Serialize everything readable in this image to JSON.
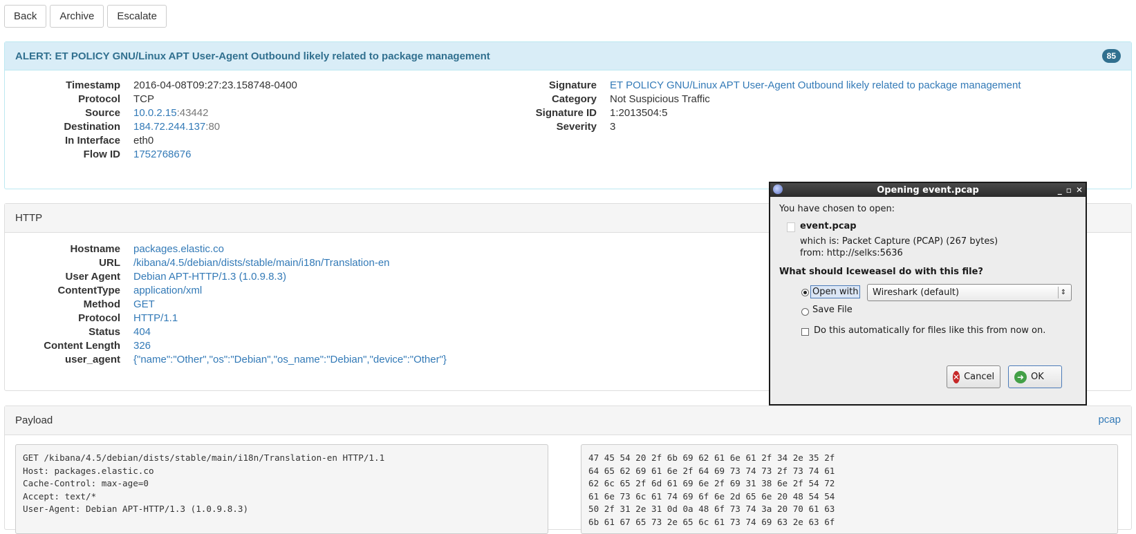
{
  "toolbar": {
    "back": "Back",
    "archive": "Archive",
    "escalate": "Escalate"
  },
  "alert": {
    "title": "ALERT: ET POLICY GNU/Linux APT User-Agent Outbound likely related to package management",
    "badge": "85",
    "left": [
      {
        "key": "Timestamp",
        "value": "2016-04-08T09:27:23.158748-0400"
      },
      {
        "key": "Protocol",
        "value": "TCP"
      },
      {
        "key": "Source",
        "value": "10.0.2.15",
        "port": ":43442"
      },
      {
        "key": "Destination",
        "value": "184.72.244.137",
        "port": ":80"
      },
      {
        "key": "In Interface",
        "value": "eth0"
      },
      {
        "key": "Flow ID",
        "value": "1752768676"
      }
    ],
    "right": [
      {
        "key": "Signature",
        "value": "ET POLICY GNU/Linux APT User-Agent Outbound likely related to package management"
      },
      {
        "key": "Category",
        "value": "Not Suspicious Traffic"
      },
      {
        "key": "Signature ID",
        "value": "1:2013504:5"
      },
      {
        "key": "Severity",
        "value": "3"
      }
    ]
  },
  "http": {
    "title": "HTTP",
    "rows": [
      {
        "key": "Hostname",
        "value": "packages.elastic.co"
      },
      {
        "key": "URL",
        "value": "/kibana/4.5/debian/dists/stable/main/i18n/Translation-en"
      },
      {
        "key": "User Agent",
        "value": "Debian APT-HTTP/1.3 (1.0.9.8.3)"
      },
      {
        "key": "ContentType",
        "value": "application/xml"
      },
      {
        "key": "Method",
        "value": "GET"
      },
      {
        "key": "Protocol",
        "value": "HTTP/1.1"
      },
      {
        "key": "Status",
        "value": "404"
      },
      {
        "key": "Content Length",
        "value": "326"
      },
      {
        "key": "user_agent",
        "value": "{\"name\":\"Other\",\"os\":\"Debian\",\"os_name\":\"Debian\",\"device\":\"Other\"}"
      }
    ]
  },
  "payload": {
    "title": "Payload",
    "pcap_link": "pcap",
    "text": "GET /kibana/4.5/debian/dists/stable/main/i18n/Translation-en HTTP/1.1\nHost: packages.elastic.co\nCache-Control: max-age=0\nAccept: text/*\nUser-Agent: Debian APT-HTTP/1.3 (1.0.9.8.3)",
    "hex": "47 45 54 20 2f 6b 69 62 61 6e 61 2f 34 2e 35 2f\n64 65 62 69 61 6e 2f 64 69 73 74 73 2f 73 74 61\n62 6c 65 2f 6d 61 69 6e 2f 69 31 38 6e 2f 54 72\n61 6e 73 6c 61 74 69 6f 6e 2d 65 6e 20 48 54 54\n50 2f 31 2e 31 0d 0a 48 6f 73 74 3a 20 70 61 63\n6b 61 67 65 73 2e 65 6c 61 73 74 69 63 2e 63 6f"
  },
  "dialog": {
    "title": "Opening event.pcap",
    "chosen": "You have chosen to open:",
    "filename": "event.pcap",
    "which_is": "which is:  Packet Capture (PCAP) (267 bytes)",
    "from": "from:  http://selks:5636",
    "question": "What should Iceweasel do with this file?",
    "open_with": "Open with",
    "app": "Wireshark (default)",
    "save_file": "Save File",
    "auto": "Do this automatically for files like this from now on.",
    "cancel": "Cancel",
    "ok": "OK",
    "controls": {
      "minimize": "_",
      "maximize": "▫",
      "close": "✕"
    }
  }
}
